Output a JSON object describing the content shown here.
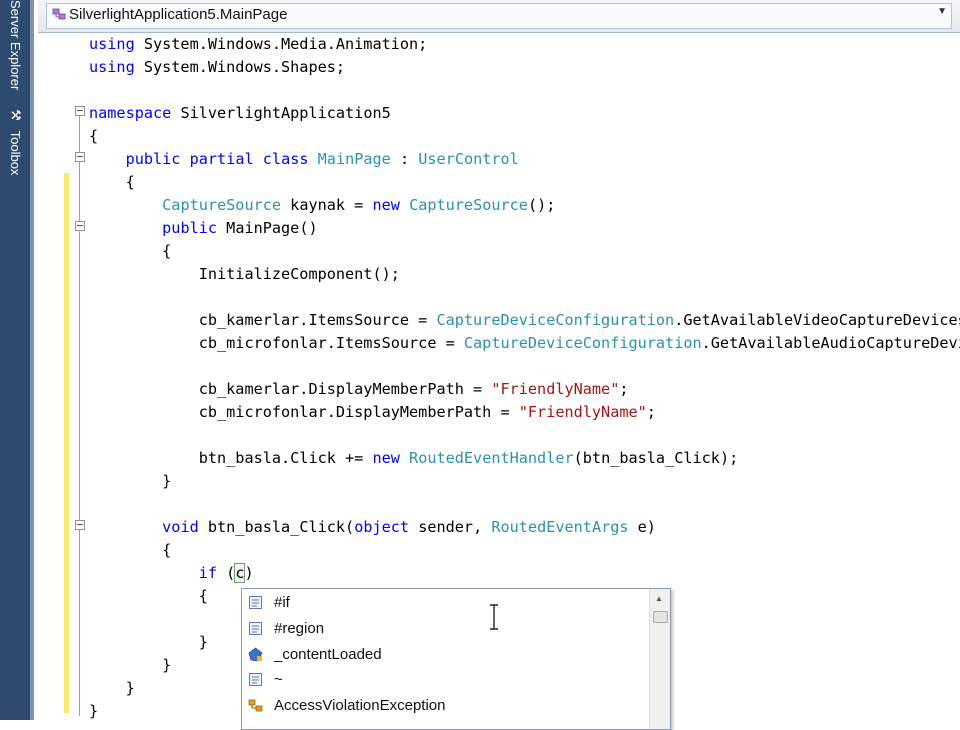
{
  "sidebar": {
    "tabs": [
      {
        "label": "Server Explorer"
      },
      {
        "label": "Toolbox",
        "icon": "toolbox-icon"
      }
    ]
  },
  "navbar": {
    "selected_type": "SilverlightApplication5.MainPage",
    "icon": "class-icon"
  },
  "editor": {
    "lines": [
      [
        {
          "t": "using",
          "c": "kw"
        },
        {
          "t": " System.Windows.Media.Animation;"
        }
      ],
      [
        {
          "t": "using",
          "c": "kw"
        },
        {
          "t": " System.Windows.Shapes;"
        }
      ],
      [],
      [
        {
          "t": "namespace",
          "c": "kw"
        },
        {
          "t": " SilverlightApplication5"
        }
      ],
      [
        {
          "t": "{"
        }
      ],
      [
        {
          "t": "    "
        },
        {
          "t": "public",
          "c": "kw"
        },
        {
          "t": " "
        },
        {
          "t": "partial",
          "c": "kw"
        },
        {
          "t": " "
        },
        {
          "t": "class",
          "c": "kw"
        },
        {
          "t": " "
        },
        {
          "t": "MainPage",
          "c": "ty"
        },
        {
          "t": " : "
        },
        {
          "t": "UserControl",
          "c": "ty"
        }
      ],
      [
        {
          "t": "    {"
        }
      ],
      [
        {
          "t": "        "
        },
        {
          "t": "CaptureSource",
          "c": "ty"
        },
        {
          "t": " kaynak = "
        },
        {
          "t": "new",
          "c": "kw"
        },
        {
          "t": " "
        },
        {
          "t": "CaptureSource",
          "c": "ty"
        },
        {
          "t": "();"
        }
      ],
      [
        {
          "t": "        "
        },
        {
          "t": "public",
          "c": "kw"
        },
        {
          "t": " MainPage()"
        }
      ],
      [
        {
          "t": "        {"
        }
      ],
      [
        {
          "t": "            InitializeComponent();"
        }
      ],
      [],
      [
        {
          "t": "            cb_kamerlar.ItemsSource = "
        },
        {
          "t": "CaptureDeviceConfiguration",
          "c": "ty"
        },
        {
          "t": ".GetAvailableVideoCaptureDevices();"
        }
      ],
      [
        {
          "t": "            cb_microfonlar.ItemsSource = "
        },
        {
          "t": "CaptureDeviceConfiguration",
          "c": "ty"
        },
        {
          "t": ".GetAvailableAudioCaptureDevices();"
        }
      ],
      [],
      [
        {
          "t": "            cb_kamerlar.DisplayMemberPath = "
        },
        {
          "t": "\"FriendlyName\"",
          "c": "str"
        },
        {
          "t": ";"
        }
      ],
      [
        {
          "t": "            cb_microfonlar.DisplayMemberPath = "
        },
        {
          "t": "\"FriendlyName\"",
          "c": "str"
        },
        {
          "t": ";"
        }
      ],
      [],
      [
        {
          "t": "            btn_basla.Click += "
        },
        {
          "t": "new",
          "c": "kw"
        },
        {
          "t": " "
        },
        {
          "t": "RoutedEventHandler",
          "c": "ty"
        },
        {
          "t": "(btn_basla_Click);"
        }
      ],
      [
        {
          "t": "        }"
        }
      ],
      [],
      [
        {
          "t": "        "
        },
        {
          "t": "void",
          "c": "kw"
        },
        {
          "t": " btn_basla_Click("
        },
        {
          "t": "object",
          "c": "kw"
        },
        {
          "t": " sender, "
        },
        {
          "t": "RoutedEventArgs",
          "c": "ty"
        },
        {
          "t": " e)"
        }
      ],
      [
        {
          "t": "        {"
        }
      ],
      [
        {
          "t": "            "
        },
        {
          "t": "if",
          "c": "kw"
        },
        {
          "t": " ("
        },
        {
          "t": "c",
          "c": "caret-char"
        },
        {
          "t": ")"
        }
      ],
      [
        {
          "t": "            {"
        }
      ],
      [],
      [
        {
          "t": "            }"
        }
      ],
      [
        {
          "t": "        }"
        }
      ],
      [
        {
          "t": "    }"
        }
      ],
      [
        {
          "t": "}"
        }
      ]
    ]
  },
  "intellisense": {
    "items": [
      {
        "label": "#if",
        "icon": "snippet-icon"
      },
      {
        "label": "#region",
        "icon": "snippet-icon"
      },
      {
        "label": "_contentLoaded",
        "icon": "field-icon"
      },
      {
        "label": "~",
        "icon": "snippet-icon"
      },
      {
        "label": "AccessViolationException",
        "icon": "class-icon"
      }
    ]
  }
}
